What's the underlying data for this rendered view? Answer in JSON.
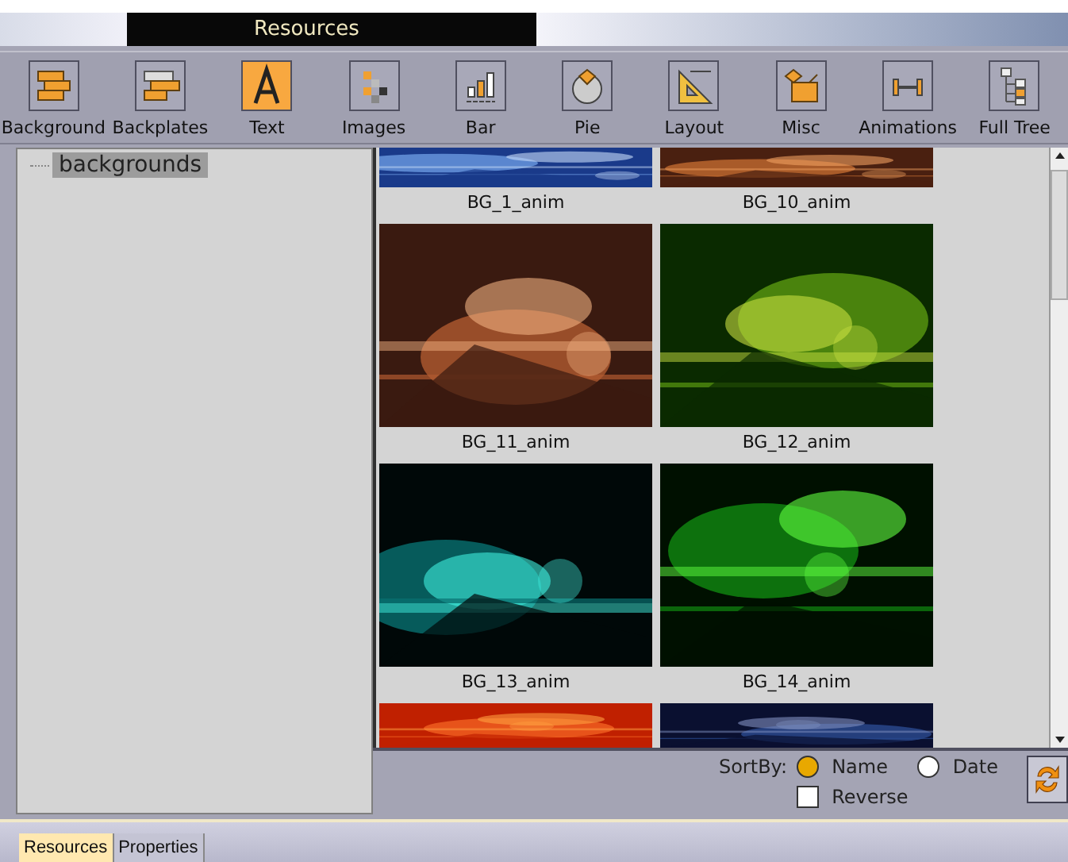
{
  "window": {
    "title": "Resources"
  },
  "toolbar": [
    {
      "label": "Background",
      "selected": false
    },
    {
      "label": "Backplates",
      "selected": false
    },
    {
      "label": "Text",
      "selected": true
    },
    {
      "label": "Images",
      "selected": false
    },
    {
      "label": "Bar",
      "selected": false
    },
    {
      "label": "Pie",
      "selected": false
    },
    {
      "label": "Layout",
      "selected": false
    },
    {
      "label": "Misc",
      "selected": false
    },
    {
      "label": "Animations",
      "selected": false
    },
    {
      "label": "Full Tree",
      "selected": false
    }
  ],
  "tree": {
    "items": [
      {
        "label": "backgrounds",
        "selected": true
      }
    ]
  },
  "thumbnails": [
    {
      "label": "BG_1_anim"
    },
    {
      "label": "BG_10_anim"
    },
    {
      "label": "BG_11_anim"
    },
    {
      "label": "BG_12_anim"
    },
    {
      "label": "BG_13_anim"
    },
    {
      "label": "BG_14_anim"
    },
    {
      "kind": "picture"
    },
    {
      "kind": "picture"
    }
  ],
  "sort": {
    "label": "SortBy:",
    "options": [
      {
        "label": "Name",
        "selected": true
      },
      {
        "label": "Date",
        "selected": false
      }
    ],
    "reverse": {
      "label": "Reverse",
      "checked": false
    }
  },
  "tabs": [
    {
      "label": "Resources",
      "selected": true
    },
    {
      "label": "Properties",
      "selected": false
    }
  ]
}
